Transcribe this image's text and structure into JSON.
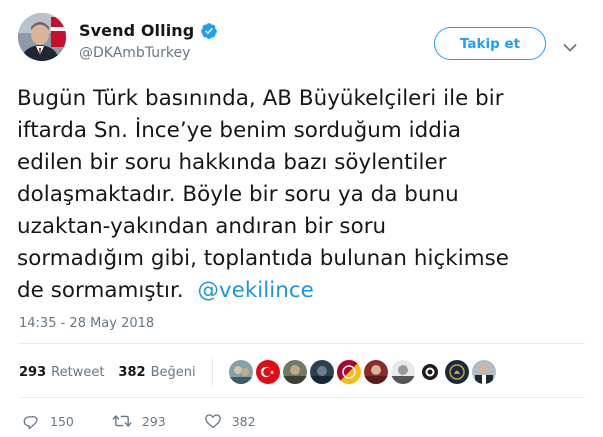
{
  "user": {
    "display_name": "Svend Olling",
    "handle": "@DKAmbTurkey",
    "verified": true
  },
  "follow_button_label": "Takip et",
  "tweet": {
    "lines": [
      "Bugün Türk basınında, AB Büyükelçileri ile bir",
      "iftarda Sn. İnce’ye benim sorduğum iddia",
      "edilen bir soru hakkında bazı söylentiler",
      "dolaşmaktadır. Böyle bir soru ya da bunu",
      "uzaktan-yakından andıran bir soru",
      "sormadığım gibi, toplantıda bulunan hiçkimse"
    ],
    "last_line_text": "de sormamıştır.",
    "mention": "@vekilince"
  },
  "timestamp": "14:35 - 28 May 2018",
  "stats": {
    "retweets_count": "293",
    "retweets_label": "Retweet",
    "likes_count": "382",
    "likes_label": "Beğeni"
  },
  "actions": {
    "reply_count": "150",
    "retweet_count": "293",
    "like_count": "382"
  },
  "colors": {
    "accent": "#1da1f2",
    "text": "#14171a",
    "muted": "#657786",
    "divider": "#e6ecf0"
  },
  "icons": [
    "verified-badge-icon",
    "chevron-down-icon",
    "reply-icon",
    "retweet-icon",
    "heart-icon"
  ]
}
